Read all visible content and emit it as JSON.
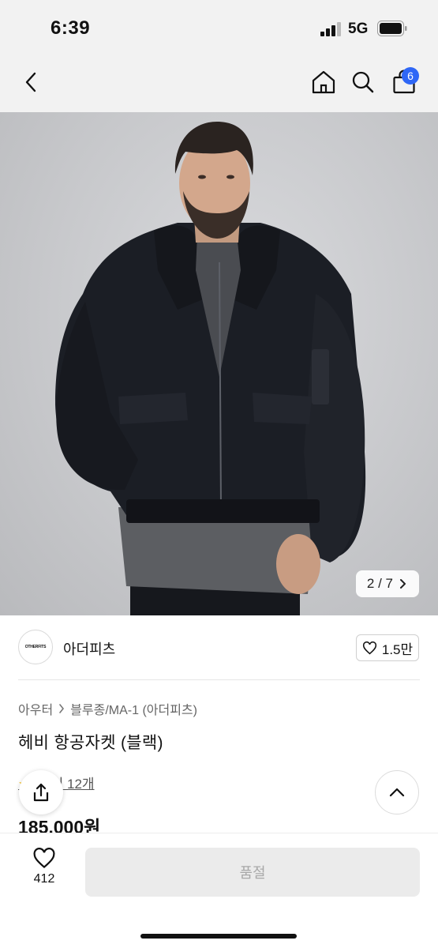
{
  "status_bar": {
    "time": "6:39",
    "network": "5G"
  },
  "nav": {
    "cart_count": "6"
  },
  "gallery": {
    "counter": "2 / 7"
  },
  "brand": {
    "name": "아더피츠",
    "logo_text": "OTHERFITS",
    "likes": "1.5만"
  },
  "breadcrumb": {
    "category": "아우터",
    "subcategory": "블루종/MA-1 (아더피츠)"
  },
  "product": {
    "title": "헤비 항공자켓 (블랙)",
    "reviews": "후기 12개",
    "price": "185,000원"
  },
  "bottom_bar": {
    "wish_count": "412",
    "purchase_label": "품절"
  },
  "colors": {
    "accent": "#2f67f6",
    "star": "#f5b800",
    "soldout_bg": "#ebebeb"
  }
}
